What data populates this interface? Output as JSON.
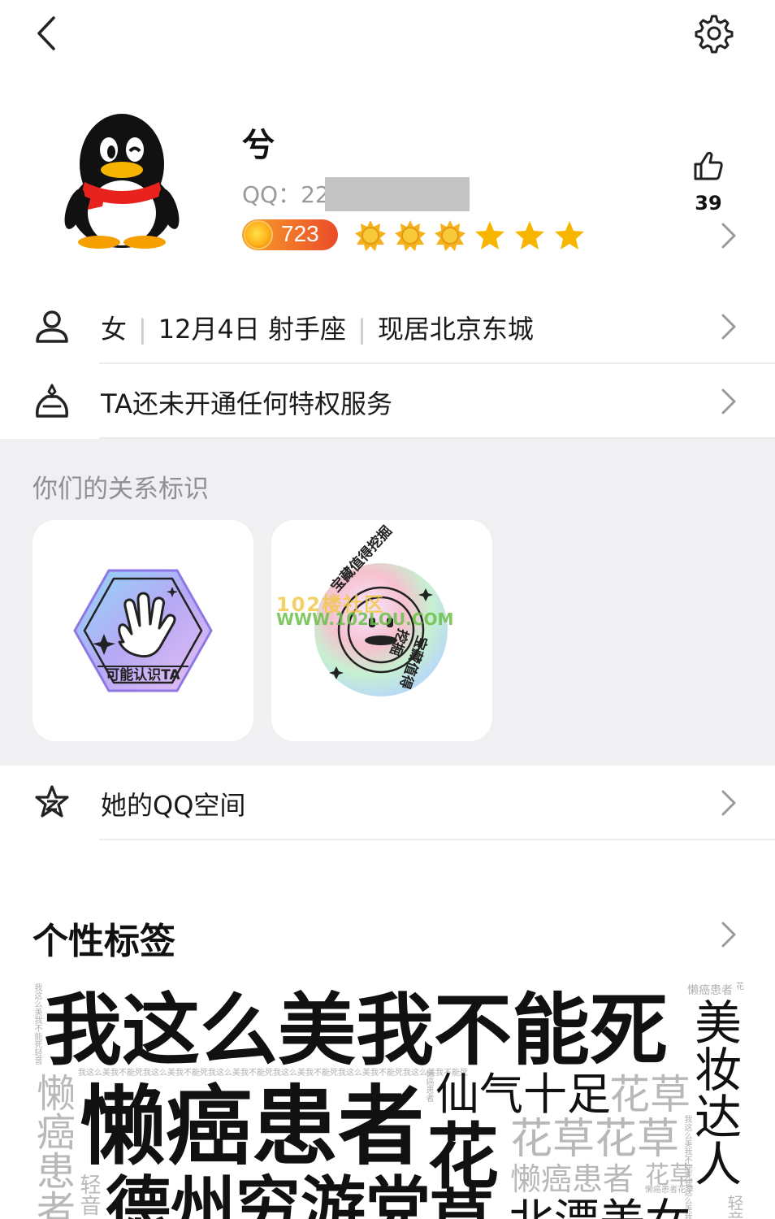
{
  "header": {
    "back_icon": "chevron-left-icon",
    "settings_icon": "gear-icon"
  },
  "profile": {
    "nickname": "兮",
    "qq_label": "QQ：22",
    "level_number": "723",
    "level_icons": [
      "sun-icon",
      "sun-icon",
      "sun-icon",
      "star-icon",
      "star-icon",
      "star-icon"
    ],
    "like_count": "39",
    "colors": {
      "level_badge": "#ec4b2a",
      "star": "#f7b500"
    }
  },
  "info_rows": [
    {
      "icon": "person-icon",
      "gender": "女",
      "birthday": "12月4日 射手座",
      "location": "现居北京东城"
    },
    {
      "icon": "vip-crown-icon",
      "text": "TA还未开通任何特权服务"
    }
  ],
  "relationship": {
    "title": "你们的关系标识",
    "cards": [
      {
        "icon": "wave-hand-badge-icon",
        "label": "可能认识TA"
      },
      {
        "icon": "treasure-badge-icon",
        "ring_text": "宝藏值得挖掘"
      }
    ],
    "watermark_line1": "102楼社区",
    "watermark_line2": "WWW.102LOU.COM"
  },
  "qzone_row": {
    "icon": "qzone-star-icon",
    "text": "她的QQ空间"
  },
  "tags": {
    "title": "个性标签",
    "big1": "我这么美我不能死",
    "big2": "懒癌患者",
    "big3": "德州穷游党",
    "mid_right": "美妆达人",
    "mid_xian": "仙气十足",
    "gray_huacao": "花草",
    "big_hua": "花",
    "gray_huacao2": "花草花草",
    "gray_lanai": "懒癌患者",
    "gray_huacao3": "花草",
    "vert_left": "懒癌患者",
    "bottom_mid": "草",
    "bottom_right": "北漂美女",
    "small_top_right": "懒癌患者",
    "small_top_right_hua": "花",
    "small_line": "我这么美我不能死我这么美我不能死我这么美我不能死我这么美我不能死我这么美我不能死我这么美我不能死",
    "small_vert1": "我这么美我不能死轻音",
    "small_vert2": "懒癌患者",
    "small_vert3": "我这么美我不能死我这么美我不",
    "small_lanai2": "懒癌患者花草",
    "small_qingyin": "轻音",
    "small_qingyin2": "轻音"
  }
}
